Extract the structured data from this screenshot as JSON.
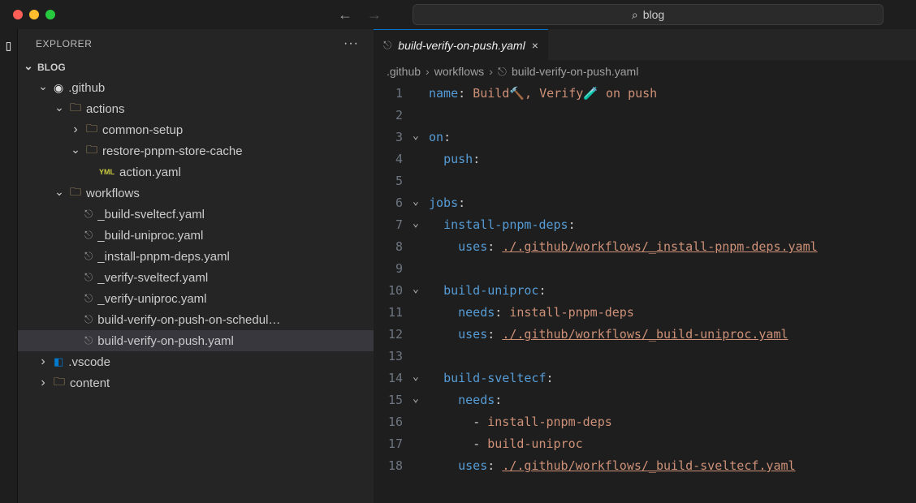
{
  "search": {
    "placeholder": "blog"
  },
  "sidebar": {
    "title": "EXPLORER",
    "section": "BLOG"
  },
  "tree": {
    "github": ".github",
    "actions": "actions",
    "common_setup": "common-setup",
    "restore_cache": "restore-pnpm-store-cache",
    "action_yaml": "action.yaml",
    "workflows": "workflows",
    "files": [
      "_build-sveltecf.yaml",
      "_build-uniproc.yaml",
      "_install-pnpm-deps.yaml",
      "_verify-sveltecf.yaml",
      "_verify-uniproc.yaml",
      "build-verify-on-push-on-schedul…",
      "build-verify-on-push.yaml"
    ],
    "vscode": ".vscode",
    "content": "content"
  },
  "tab": {
    "label": "build-verify-on-push.yaml",
    "close": "×"
  },
  "breadcrumbs": [
    ".github",
    "workflows",
    "build-verify-on-push.yaml"
  ],
  "code": {
    "lines": [
      {
        "n": 1,
        "fold": false,
        "html": "<span class='tok-key'>name</span><span class='tok-punc'>:</span> <span class='tok-str'>Build🔨, Verify🧪 on push</span>"
      },
      {
        "n": 2,
        "fold": false,
        "html": ""
      },
      {
        "n": 3,
        "fold": true,
        "html": "<span class='tok-key'>on</span><span class='tok-punc'>:</span>"
      },
      {
        "n": 4,
        "fold": false,
        "html": "  <span class='tok-key'>push</span><span class='tok-punc'>:</span>"
      },
      {
        "n": 5,
        "fold": false,
        "html": ""
      },
      {
        "n": 6,
        "fold": true,
        "html": "<span class='tok-key'>jobs</span><span class='tok-punc'>:</span>"
      },
      {
        "n": 7,
        "fold": true,
        "html": "  <span class='tok-prop'>install-pnpm-deps</span><span class='tok-punc'>:</span>"
      },
      {
        "n": 8,
        "fold": false,
        "html": "    <span class='tok-key'>uses</span><span class='tok-punc'>:</span> <span class='tok-link'>./.github/workflows/_install-pnpm-deps.yaml</span>"
      },
      {
        "n": 9,
        "fold": false,
        "html": ""
      },
      {
        "n": 10,
        "fold": true,
        "html": "  <span class='tok-prop'>build-uniproc</span><span class='tok-punc'>:</span>"
      },
      {
        "n": 11,
        "fold": false,
        "html": "    <span class='tok-key'>needs</span><span class='tok-punc'>:</span> <span class='tok-str'>install-pnpm-deps</span>"
      },
      {
        "n": 12,
        "fold": false,
        "html": "    <span class='tok-key'>uses</span><span class='tok-punc'>:</span> <span class='tok-link'>./.github/workflows/_build-uniproc.yaml</span>"
      },
      {
        "n": 13,
        "fold": false,
        "html": ""
      },
      {
        "n": 14,
        "fold": true,
        "html": "  <span class='tok-prop'>build-sveltecf</span><span class='tok-punc'>:</span>"
      },
      {
        "n": 15,
        "fold": true,
        "html": "    <span class='tok-key'>needs</span><span class='tok-punc'>:</span>"
      },
      {
        "n": 16,
        "fold": false,
        "html": "      <span class='tok-punc'>-</span> <span class='tok-str'>install-pnpm-deps</span>"
      },
      {
        "n": 17,
        "fold": false,
        "html": "      <span class='tok-punc'>-</span> <span class='tok-str'>build-uniproc</span>"
      },
      {
        "n": 18,
        "fold": false,
        "html": "    <span class='tok-key'>uses</span><span class='tok-punc'>:</span> <span class='tok-link'>./.github/workflows/_build-sveltecf.yaml</span>"
      }
    ]
  }
}
